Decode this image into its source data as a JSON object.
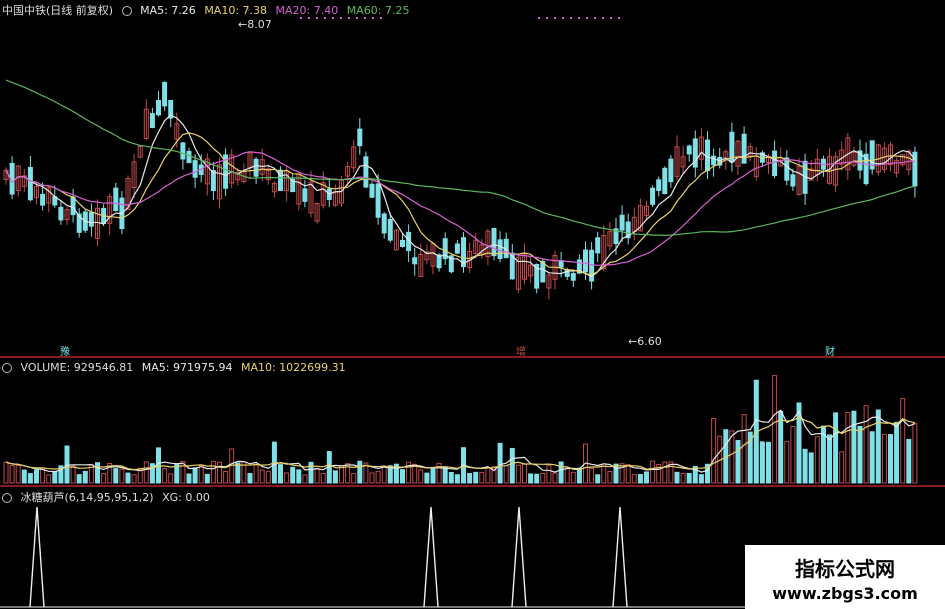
{
  "price_panel": {
    "stock_name": "中国中铁(日线 前复权)",
    "ma5_label": "MA5: 7.26",
    "ma10_label": "MA10: 7.38",
    "ma20_label": "MA20: 7.40",
    "ma60_label": "MA60: 7.25",
    "high_marker": "8.07",
    "low_marker": "6.60",
    "event_tags": [
      "豫",
      "增",
      "财"
    ],
    "colors": {
      "up": "#c24a4a",
      "down": "#7fe0e8",
      "ma5": "#e8e8e8",
      "ma10": "#e8d36a",
      "ma20": "#d760d7",
      "ma60": "#5cb85c"
    }
  },
  "volume_panel": {
    "volume_label": "VOLUME: 929546.81",
    "ma5_label": "MA5: 971975.94",
    "ma10_label": "MA10: 1022699.31"
  },
  "indicator_panel": {
    "indicator_label": "冰糖葫芦(6,14,95,95,1,2)",
    "xg_label": "XG: 0.00"
  },
  "watermark": {
    "title": "指标公式网",
    "url": "www.zbgs3.com"
  }
}
